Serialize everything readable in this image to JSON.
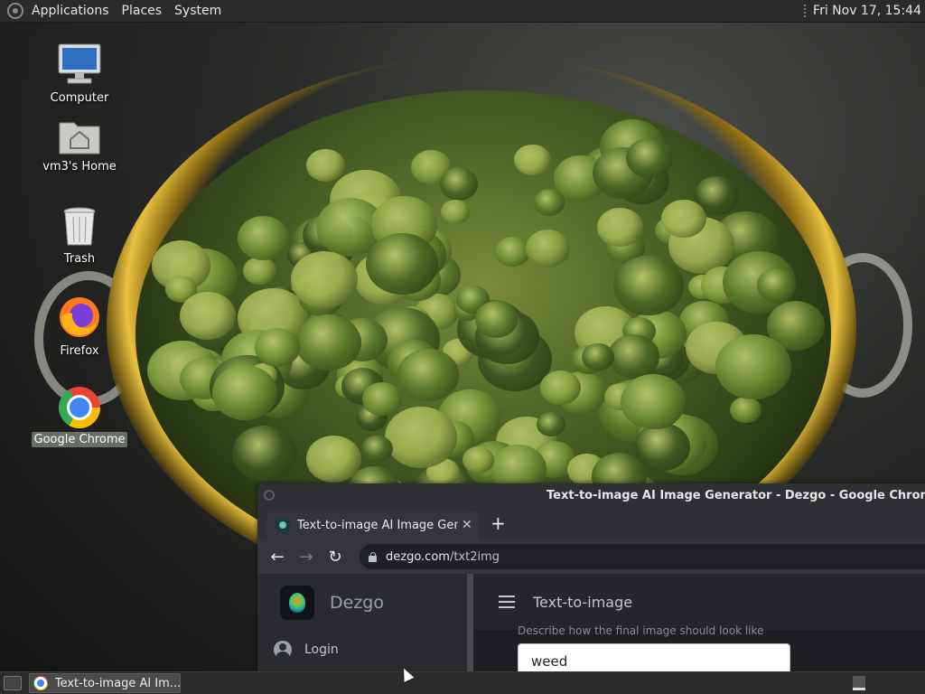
{
  "top_panel": {
    "menus": [
      "Applications",
      "Places",
      "System"
    ],
    "clock": "Fri Nov 17, 15:44"
  },
  "desktop": {
    "icons": [
      {
        "label": "Computer",
        "icon": "computer-icon"
      },
      {
        "label": "vm3's Home",
        "icon": "home-folder-icon"
      },
      {
        "label": "Trash",
        "icon": "trash-icon"
      },
      {
        "label": "Firefox",
        "icon": "firefox-icon"
      },
      {
        "label": "Google Chrome",
        "icon": "chrome-icon",
        "selected": true
      }
    ]
  },
  "chrome": {
    "window_title": "Text-to-image AI Image Generator - Dezgo - Google Chrome",
    "tab_title": "Text-to-image AI Image Generator",
    "tab_close": "✕",
    "new_tab": "+",
    "url_domain": "dezgo.com",
    "url_path": "/txt2img",
    "nav": {
      "back": "←",
      "forward": "→",
      "reload": "↻"
    }
  },
  "page": {
    "brand": "Dezgo",
    "login": "Login",
    "title": "Text-to-image",
    "prompt_hint": "Describe how the final image should look like",
    "prompt_value": "weed"
  },
  "taskbar": {
    "task_label": "Text-to-image AI Im..."
  },
  "colors": {
    "panel_bg": "#2b2b2b",
    "chrome_dark": "#202124",
    "chrome_toolbar": "#35363a",
    "sidebar_bg": "#2a2b2f",
    "bowl_gold": "#e8c140",
    "bud_green": "#5a7a2a"
  }
}
